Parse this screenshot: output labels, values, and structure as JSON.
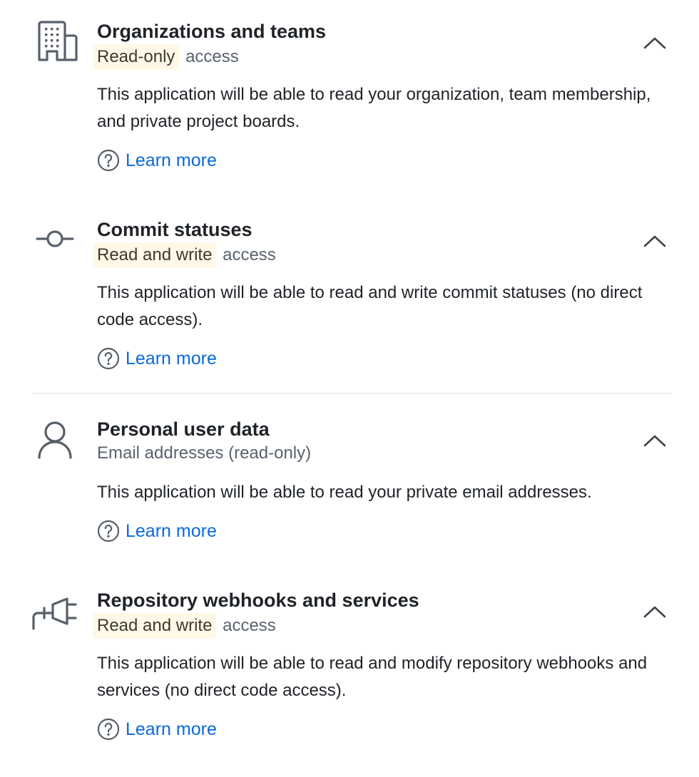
{
  "permissions": [
    {
      "icon": "organization-icon",
      "title": "Organizations and teams",
      "access_level": "Read-only",
      "access_suffix": "access",
      "description": "This application will be able to read your organization, team membership, and private project boards.",
      "learn_more": "Learn more"
    },
    {
      "icon": "commit-icon",
      "title": "Commit statuses",
      "access_level": "Read and write",
      "access_suffix": "access",
      "description": "This application will be able to read and write commit statuses (no direct code access).",
      "learn_more": "Learn more"
    },
    {
      "icon": "person-icon",
      "title": "Personal user data",
      "subtitle": "Email addresses (read-only)",
      "description": "This application will be able to read your private email addresses.",
      "learn_more": "Learn more"
    },
    {
      "icon": "plug-icon",
      "title": "Repository webhooks and services",
      "access_level": "Read and write",
      "access_suffix": "access",
      "description": "This application will be able to read and modify repository webhooks and services (no direct code access).",
      "learn_more": "Learn more"
    }
  ],
  "colors": {
    "link": "#0969da",
    "highlight_bg": "#fff8e6",
    "muted_text": "#59636e",
    "icon_stroke": "#57606a"
  }
}
